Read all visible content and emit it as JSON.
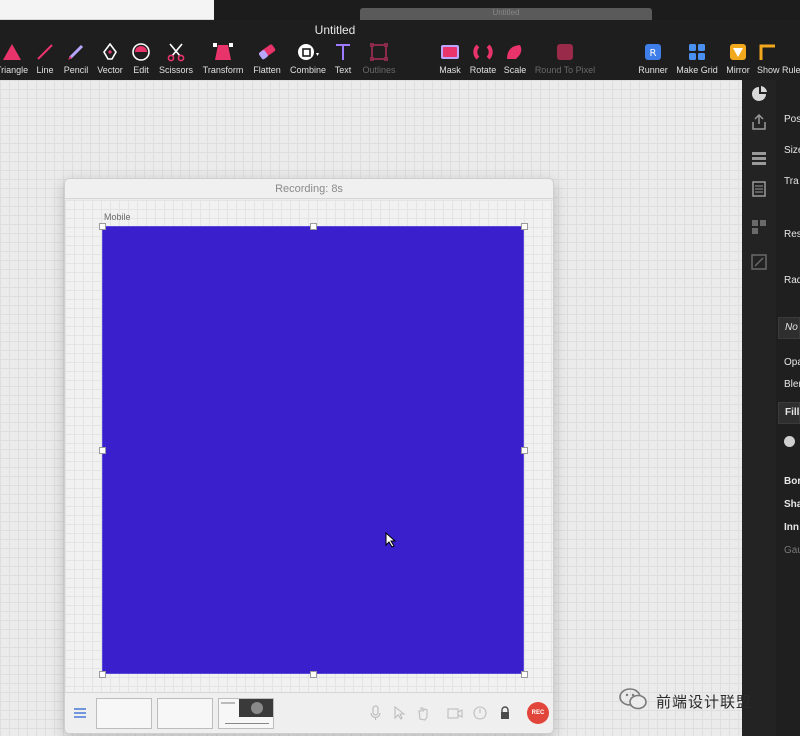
{
  "window": {
    "title": "Untitled",
    "ghost_tab_title": "Untitled"
  },
  "toolbar": {
    "tools": [
      {
        "id": "triangle",
        "label": "Triangle",
        "icon": "triangle-icon",
        "enabled": true
      },
      {
        "id": "line",
        "label": "Line",
        "icon": "line-icon",
        "enabled": true
      },
      {
        "id": "pencil",
        "label": "Pencil",
        "icon": "pencil-icon",
        "enabled": true
      },
      {
        "id": "vector",
        "label": "Vector",
        "icon": "pen-nib-icon",
        "enabled": true
      },
      {
        "id": "edit",
        "label": "Edit",
        "icon": "edit-shape-icon",
        "enabled": true
      },
      {
        "id": "scissors",
        "label": "Scissors",
        "icon": "scissors-icon",
        "enabled": true
      },
      {
        "id": "transform",
        "label": "Transform",
        "icon": "transform-icon",
        "enabled": true
      },
      {
        "id": "flatten",
        "label": "Flatten",
        "icon": "eraser-icon",
        "enabled": true
      },
      {
        "id": "combine",
        "label": "Combine",
        "icon": "combine-icon",
        "enabled": true
      },
      {
        "id": "text",
        "label": "Text",
        "icon": "text-icon",
        "enabled": true
      },
      {
        "id": "outlines",
        "label": "Outlines",
        "icon": "outlines-icon",
        "enabled": false
      },
      {
        "id": "mask",
        "label": "Mask",
        "icon": "mask-icon",
        "enabled": true
      },
      {
        "id": "rotate",
        "label": "Rotate",
        "icon": "rotate-icon",
        "enabled": true
      },
      {
        "id": "scale",
        "label": "Scale",
        "icon": "scale-icon",
        "enabled": true
      },
      {
        "id": "round_to_pixel",
        "label": "Round To Pixel",
        "icon": "round-to-pixel-icon",
        "enabled": false
      },
      {
        "id": "runner",
        "label": "Runner",
        "icon": "runner-icon",
        "enabled": true
      },
      {
        "id": "make_grid",
        "label": "Make Grid",
        "icon": "grid-icon",
        "enabled": true
      },
      {
        "id": "mirror",
        "label": "Mirror",
        "icon": "mirror-icon",
        "enabled": true
      },
      {
        "id": "show_rulers",
        "label": "Show Rulers",
        "icon": "ruler-icon",
        "enabled": true
      }
    ]
  },
  "inspector": {
    "labels": {
      "position": "Pos",
      "size": "Size",
      "transform": "Tra",
      "resizing": "Res",
      "radius": "Rad",
      "style": "No",
      "opacity": "Opa",
      "blending": "Blen",
      "fills": "Fills",
      "borders": "Bor",
      "shadows": "Sha",
      "inner_shadows": "Inn",
      "gaussian_blur": "Gau"
    }
  },
  "recording": {
    "title": "Recording: 8s",
    "artboard_label": "Mobile",
    "artboard_color": "#3a20cc",
    "rec_label": "REC"
  },
  "watermark": {
    "text": "前端设计联盟"
  },
  "colors": {
    "accent_pink": "#e8336b",
    "toolbar_bg": "#1e1e1e",
    "rec_red": "#e2463a"
  }
}
